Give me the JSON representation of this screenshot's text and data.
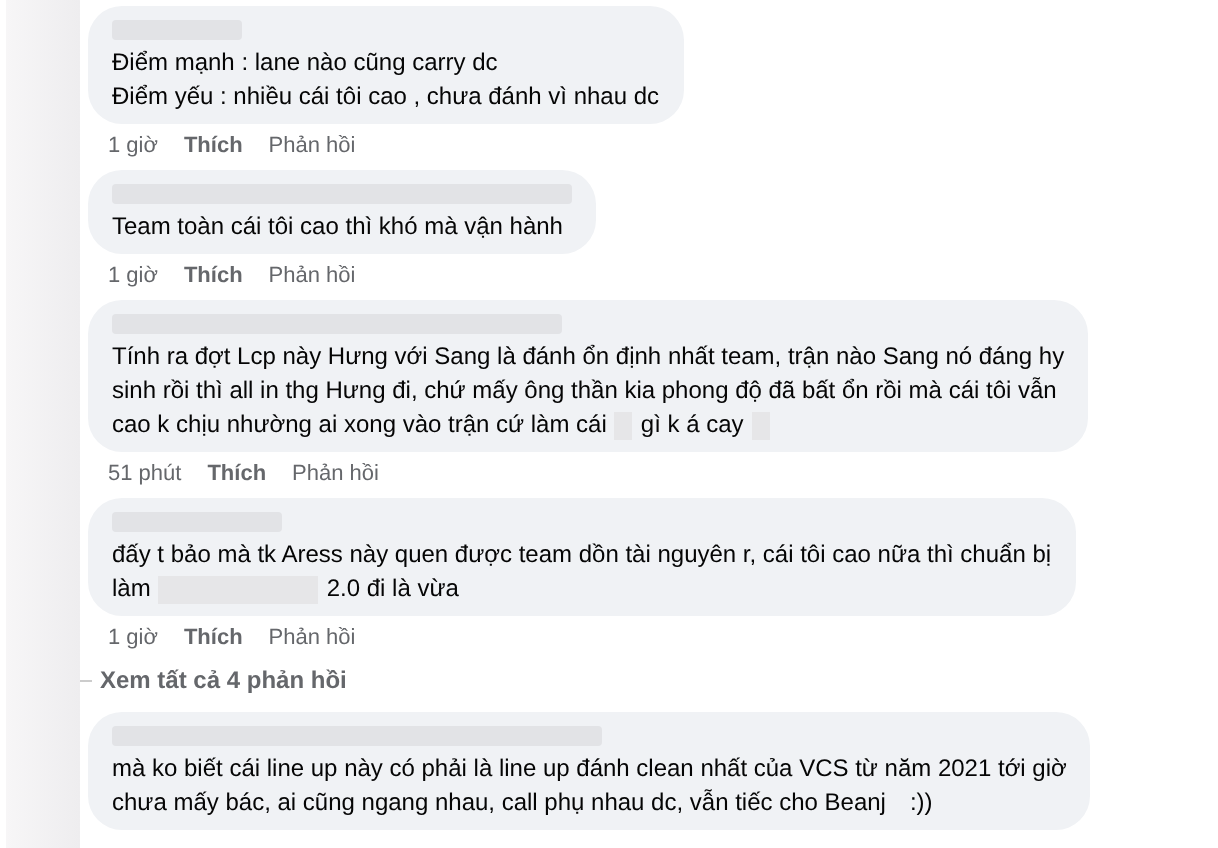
{
  "items": [
    {
      "kind": "comment",
      "lines": [
        [
          {
            "text": "Điểm mạnh : lane nào cũng carry dc"
          }
        ],
        [
          {
            "text": "Điểm yếu : nhiều cái tôi cao , chưa đánh vì nhau dc"
          }
        ]
      ],
      "time": "1 giờ",
      "like": "Thích",
      "reply": "Phản hồi"
    },
    {
      "kind": "comment",
      "lines": [
        [
          {
            "text": "Team toàn cái tôi cao thì khó mà vận hành"
          }
        ]
      ],
      "time": "1 giờ",
      "like": "Thích",
      "reply": "Phản hồi"
    },
    {
      "kind": "comment",
      "lines": [
        [
          {
            "text": "Tính ra đợt Lcp này Hưng với Sang là đánh ổn định nhất team, trận nào Sang nó đáng hy"
          }
        ],
        [
          {
            "text": "sinh rồi thì all in thg Hưng đi, chứ mấy ông thần kia phong độ đã bất ổn rồi mà cái tôi vẫn"
          }
        ],
        [
          {
            "text": "cao k chịu nhường ai xong vào trận cứ làm cái"
          },
          {
            "kind": "redaction_short"
          },
          {
            "text": "gì k á cay"
          },
          {
            "kind": "redaction_short"
          }
        ]
      ],
      "time": "51 phút",
      "like": "Thích",
      "reply": "Phản hồi"
    },
    {
      "kind": "comment",
      "lines": [
        [
          {
            "text": "đấy t bảo mà tk Aress này quen được team dồn tài nguyên r, cái tôi cao nữa thì chuẩn bị"
          }
        ],
        [
          {
            "text": "làm"
          },
          {
            "kind": "redaction_long"
          },
          {
            "text": "2.0 đi là vừa"
          }
        ]
      ],
      "time": "1 giờ",
      "like": "Thích",
      "reply": "Phản hồi"
    },
    {
      "kind": "more",
      "label": "Xem tất cả 4 phản hồi"
    },
    {
      "kind": "comment",
      "lines": [
        [
          {
            "text": "mà ko biết cái line up này có phải là line up đánh clean nhất của VCS từ năm 2021 tới giờ"
          }
        ],
        [
          {
            "text": "chưa mấy bác, ai cũng ngang nhau, call phụ nhau dc, vẫn tiếc cho Beanj"
          },
          {
            "kind": "gap"
          },
          {
            "text": ":))"
          }
        ]
      ]
    }
  ]
}
